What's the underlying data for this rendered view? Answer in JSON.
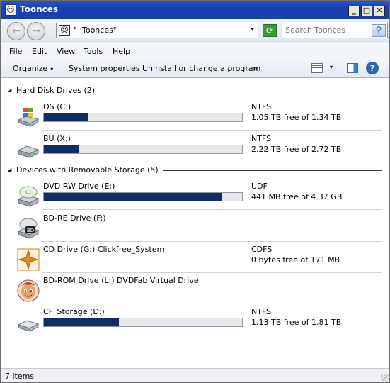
{
  "window": {
    "title": "Toonces"
  },
  "address": {
    "path": "Toonces",
    "sep": "▸",
    "path_drop": "▾",
    "dropdown": "▾"
  },
  "search": {
    "placeholder": "Search Toonces"
  },
  "menu": [
    "File",
    "Edit",
    "View",
    "Tools",
    "Help"
  ],
  "toolbar": {
    "organize": "Organize",
    "caret": "▾",
    "system_properties": "System properties",
    "uninstall": "Uninstall or change a program",
    "more": "»"
  },
  "groups": {
    "hard_disk": "Hard Disk Drives (2)",
    "removable": "Devices with Removable Storage (5)"
  },
  "drives": [
    {
      "name": "OS (C:)",
      "fs": "NTFS",
      "free": "1.05 TB free of 1.34 TB",
      "used_fraction": 0.22,
      "icon": "windows-drive-icon"
    },
    {
      "name": "BU (X:)",
      "fs": "NTFS",
      "free": "2.22 TB free of 2.72 TB",
      "used_fraction": 0.18,
      "icon": "hard-drive-icon"
    },
    {
      "name": "DVD RW Drive (E:)",
      "fs": "UDF",
      "free": "441 MB free of 4.37 GB",
      "used_fraction": 0.9,
      "icon": "dvd-drive-icon"
    },
    {
      "name": "BD-RE Drive (F:)",
      "fs": "",
      "free": "",
      "icon": "bd-drive-icon"
    },
    {
      "name": "CD Drive (G:) Clickfree_System",
      "fs": "CDFS",
      "free": "0 bytes free of 171 MB",
      "icon": "clickfree-icon"
    },
    {
      "name": "BD-ROM Drive (L:) DVDFab Virtual Drive",
      "fs": "",
      "free": "",
      "icon": "dvdfab-icon"
    },
    {
      "name": "CF_Storage (D:)",
      "fs": "NTFS",
      "free": "1.13 TB free of 1.81 TB",
      "used_fraction": 0.38,
      "icon": "flash-drive-icon"
    }
  ],
  "status": {
    "items": "7 items"
  },
  "colors": {
    "title_bar": "#1741b1",
    "usage_bar": "#132c63"
  }
}
